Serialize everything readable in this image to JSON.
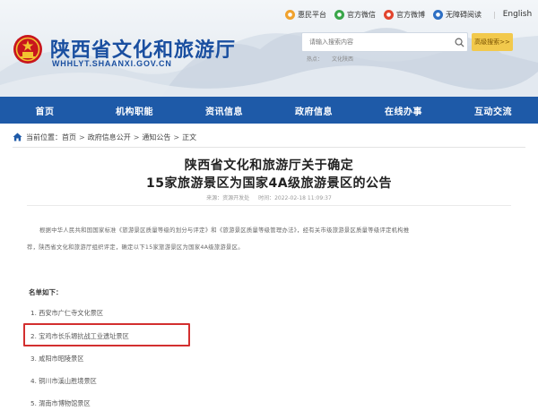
{
  "topbar": {
    "links": [
      {
        "label": "惠民平台",
        "icon": "people-icon",
        "color": "#f0a22e"
      },
      {
        "label": "官方微信",
        "icon": "wechat-icon",
        "color": "#3aa64a"
      },
      {
        "label": "官方微博",
        "icon": "weibo-icon",
        "color": "#e2452f"
      },
      {
        "label": "无障碍阅读",
        "icon": "accessibility-icon",
        "color": "#2d6fc4"
      }
    ],
    "english": "English"
  },
  "site": {
    "title": "陕西省文化和旅游厅",
    "domain": "WHHLYT.SHAANXI.GOV.CN"
  },
  "search": {
    "placeholder": "请输入搜索内容",
    "advanced_label": "高级搜索>>",
    "hints": [
      "热点：",
      "文化陕西"
    ]
  },
  "nav": {
    "items": [
      "首页",
      "机构职能",
      "资讯信息",
      "政府信息",
      "在线办事",
      "互动交流"
    ]
  },
  "breadcrumb": {
    "prefix": "当前位置：",
    "items": [
      "首页",
      "政府信息公开",
      "通知公告",
      "正文"
    ],
    "separator": ">"
  },
  "article": {
    "title_line1": "陕西省文化和旅游厅关于确定",
    "title_line2": "15家旅游景区为国家4A级旅游景区的公告",
    "source": "来源：资源开发处",
    "time": "时间：2022-02-18 11:09:37",
    "para1": "根据中华人民共和国国家标准《旅游景区质量等级的划分与评定》和《旅游景区质量等级管理办法》，经有关市级旅游景区质量等级评定机构推",
    "para2": "荐，陕西省文化和旅游厅组织评定，确定以下15家旅游景区为国家4A级旅游景区。",
    "list_heading": "名单如下：",
    "list": [
      "1. 西安市广仁寺文化景区",
      "2. 宝鸡市长乐塬抗战工业遗址景区",
      "3. 咸阳市昭陵景区",
      "4. 铜川市溪山胜境景区",
      "5. 渭南市博物馆景区"
    ],
    "highlighted_index": 1,
    "highlight_color": "#d32f2f"
  },
  "colors": {
    "nav_bg": "#1e5aa8",
    "brand_blue": "#1a4fa0",
    "advanced_btn": "#f2c94c"
  }
}
